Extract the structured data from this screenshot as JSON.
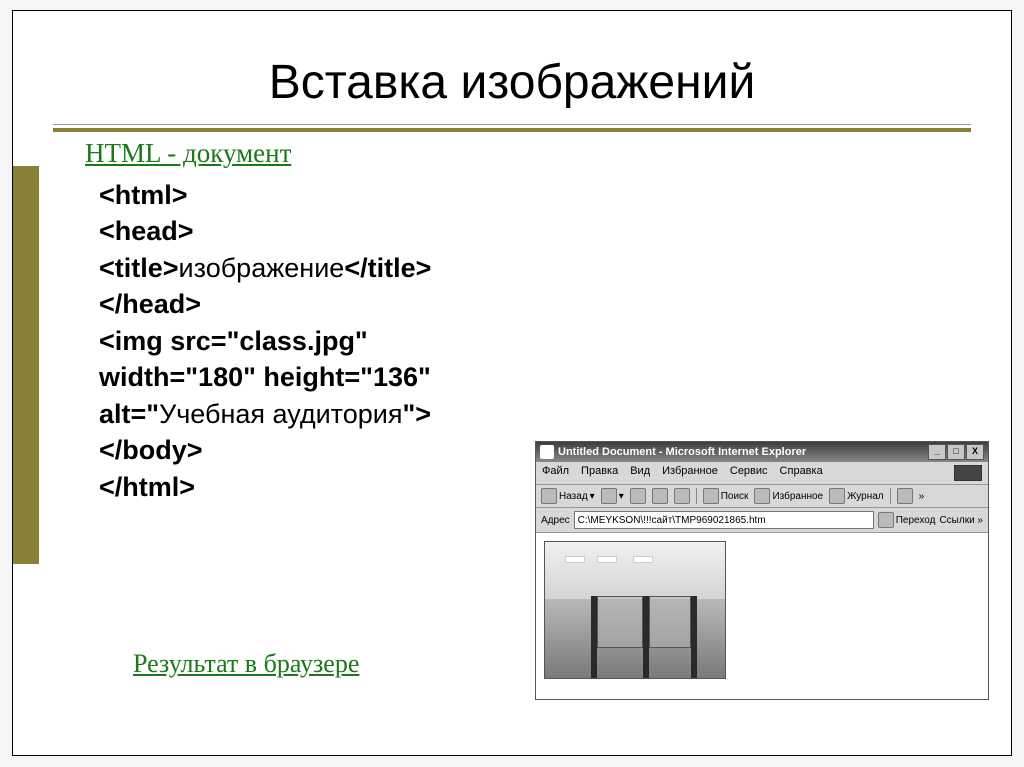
{
  "slide": {
    "title": "Вставка изображений",
    "subhead": "HTML - документ",
    "result_label": "Результат в браузере",
    "code": {
      "l1": "<html>",
      "l2": "<head>",
      "l3a": "<title>",
      "l3b": "изображение",
      "l3c": "</title>",
      "l4": "</head>",
      "l5": "<img src=\"class.jpg\"",
      "l6": "width=\"180\" height=\"136\"",
      "l7a": "alt=\"",
      "l7b": "Учебная аудитория",
      "l7c": "\">",
      "l8": "</body>",
      "l9": "</html>"
    }
  },
  "browser": {
    "title": "Untitled Document - Microsoft Internet Explorer",
    "window_buttons": {
      "min": "_",
      "max": "□",
      "close": "X"
    },
    "menus": [
      "Файл",
      "Правка",
      "Вид",
      "Избранное",
      "Сервис",
      "Справка"
    ],
    "toolbar": {
      "back": "Назад",
      "search": "Поиск",
      "favorites": "Избранное",
      "journal": "Журнал"
    },
    "address": {
      "label": "Адрес",
      "value": "C:\\MEYKSON\\!!!сайт\\TMP969021865.htm",
      "go": "Переход",
      "links": "Ссылки »"
    }
  }
}
